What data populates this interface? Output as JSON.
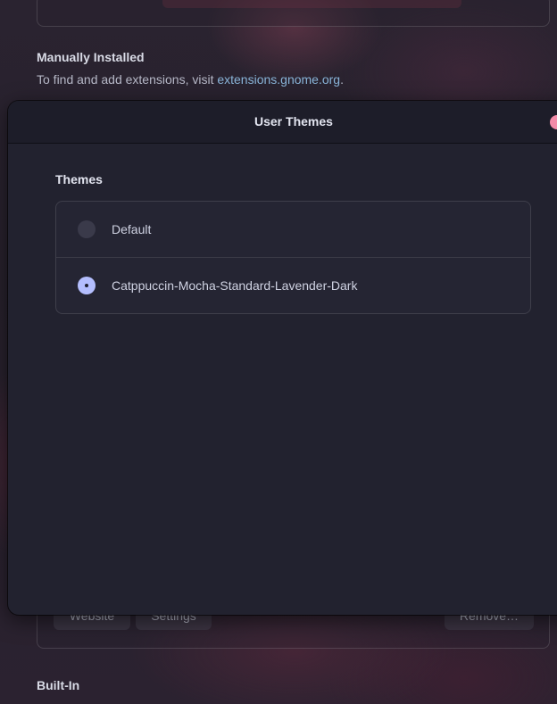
{
  "background": {
    "manual_section": {
      "title": "Manually Installed",
      "description_prefix": "To find and add extensions, visit ",
      "link_text": "extensions.gnome.org",
      "description_suffix": "."
    },
    "extension_card": {
      "website_button": "Website",
      "settings_button": "Settings",
      "remove_button": "Remove…"
    },
    "builtin_section": {
      "title": "Built-In"
    }
  },
  "dialog": {
    "title": "User Themes",
    "close_color": "#f38ba8",
    "group_title": "Themes",
    "themes": [
      {
        "label": "Default",
        "selected": false
      },
      {
        "label": "Catppuccin-Mocha-Standard-Lavender-Dark",
        "selected": true
      }
    ]
  },
  "colors": {
    "accent": "#b4befe",
    "link": "#89b4d8",
    "dialog_bg": "#22222f"
  }
}
